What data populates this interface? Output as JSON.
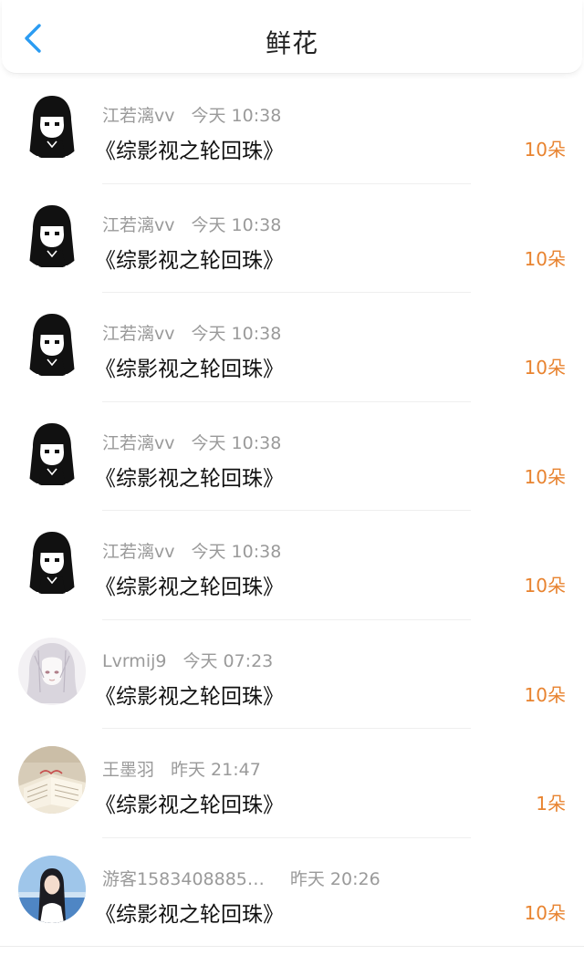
{
  "header": {
    "title": "鲜花",
    "back_icon": "chevron-left-icon",
    "accent": "#2b9cf2"
  },
  "colors": {
    "count": "#e8832f",
    "meta": "#9a9a9a"
  },
  "flowers": [
    {
      "user": "江若漓vv",
      "time": "今天 10:38",
      "book": "《综影视之轮回珠》",
      "count": "10朵",
      "avatar": "anime-girl-black-hair-icon"
    },
    {
      "user": "江若漓vv",
      "time": "今天 10:38",
      "book": "《综影视之轮回珠》",
      "count": "10朵",
      "avatar": "anime-girl-black-hair-icon"
    },
    {
      "user": "江若漓vv",
      "time": "今天 10:38",
      "book": "《综影视之轮回珠》",
      "count": "10朵",
      "avatar": "anime-girl-black-hair-icon"
    },
    {
      "user": "江若漓vv",
      "time": "今天 10:38",
      "book": "《综影视之轮回珠》",
      "count": "10朵",
      "avatar": "anime-girl-black-hair-icon"
    },
    {
      "user": "江若漓vv",
      "time": "今天 10:38",
      "book": "《综影视之轮回珠》",
      "count": "10朵",
      "avatar": "anime-girl-black-hair-icon"
    },
    {
      "user": "Lvrmij9",
      "time": "今天 07:23",
      "book": "《综影视之轮回珠》",
      "count": "10朵",
      "avatar": "anime-girl-white-hair-icon"
    },
    {
      "user": "王墨羽",
      "time": "昨天 21:47",
      "book": "《综影视之轮回珠》",
      "count": "1朵",
      "avatar": "open-book-photo-icon"
    },
    {
      "user": "游客1583408885…",
      "time": "昨天 20:26",
      "book": "《综影视之轮回珠》",
      "count": "10朵",
      "avatar": "girl-seaside-photo-icon"
    }
  ]
}
